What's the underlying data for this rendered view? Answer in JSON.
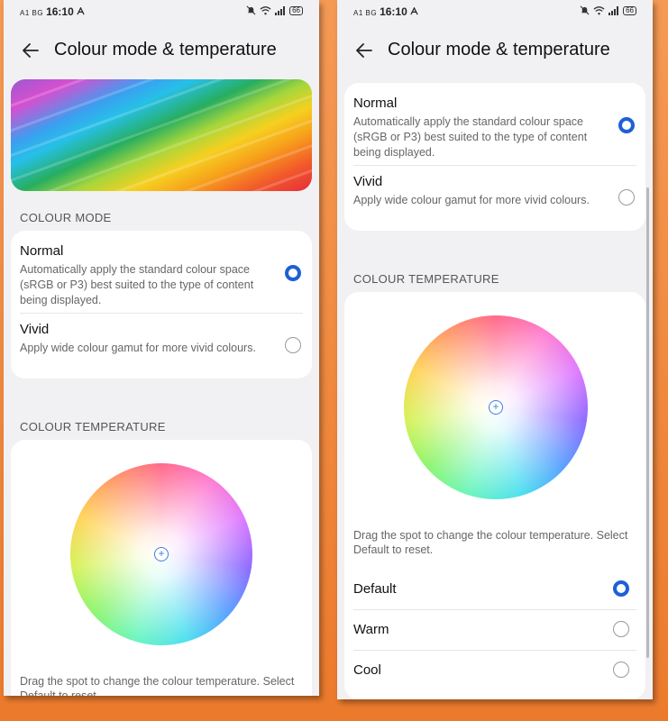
{
  "status_bar": {
    "carrier": "A1 BG",
    "time": "16:10",
    "battery": "66"
  },
  "header": {
    "title": "Colour mode & temperature"
  },
  "colour_mode": {
    "section_label": "COLOUR MODE",
    "options": [
      {
        "title": "Normal",
        "description": "Automatically apply the standard colour space (sRGB or P3) best suited to the type of content being displayed.",
        "selected": true
      },
      {
        "title": "Vivid",
        "description": "Apply wide colour gamut for more vivid colours.",
        "selected": false
      }
    ]
  },
  "colour_temperature": {
    "section_label": "COLOUR TEMPERATURE",
    "help_text": "Drag the spot to change the colour temperature. Select Default to reset.",
    "presets": [
      {
        "label": "Default",
        "selected": true
      },
      {
        "label": "Warm",
        "selected": false
      },
      {
        "label": "Cool",
        "selected": false
      }
    ]
  },
  "colors": {
    "accent": "#1f5fd6",
    "background": "#f1f1f3",
    "card": "#ffffff",
    "frame": "#f2873a"
  },
  "icons": {
    "back": "arrow-left-icon",
    "mute": "bell-off-icon",
    "wifi": "wifi-icon",
    "signal": "signal-icon",
    "battery": "battery-icon",
    "picker": "crosshair-icon"
  }
}
